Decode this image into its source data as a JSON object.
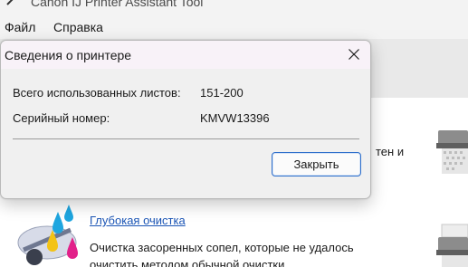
{
  "window": {
    "title": "Canon IJ Printer Assistant Tool",
    "menu": {
      "file": "Файл",
      "help": "Справка"
    }
  },
  "background": {
    "cut_text": "тен и",
    "deep_cleaning_link": "Глубокая очистка",
    "deep_cleaning_desc_line1": "Очистка засоренных сопел, которые не удалось",
    "deep_cleaning_desc_line2": "очистить методом обычной очистки"
  },
  "dialog": {
    "title": "Сведения о принтере",
    "sheets_label": "Всего использованных листов:",
    "sheets_value": "151-200",
    "serial_label": "Серийный номер:",
    "serial_value": "KMVW13396",
    "close_button": "Закрыть",
    "close_icon": "close-icon"
  },
  "colors": {
    "link": "#1b55b5",
    "button_border": "#2f6fcb",
    "dialog_bg": "#f0f0f0",
    "dialog_title_bg": "#f8f2f8"
  }
}
